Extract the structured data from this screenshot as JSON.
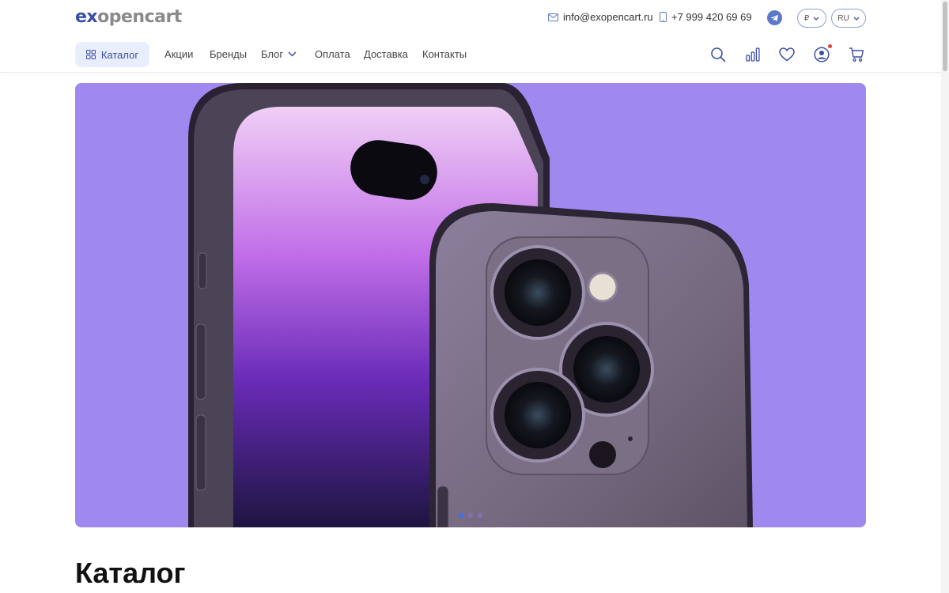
{
  "header": {
    "logo": {
      "ex": "ex",
      "rest": "opencart"
    },
    "email": "info@exopencart.ru",
    "phone": "+7 999 420 69 69",
    "currency": "₽",
    "language": "RU"
  },
  "nav": {
    "catalog_label": "Каталог",
    "items": [
      {
        "label": "Акции"
      },
      {
        "label": "Бренды"
      },
      {
        "label": "Блог"
      },
      {
        "label": "Оплата"
      },
      {
        "label": "Доставка"
      },
      {
        "label": "Контакты"
      }
    ]
  },
  "banner": {
    "slides": 3,
    "active_slide": 1,
    "background": "#9f89ef"
  },
  "section": {
    "title": "Каталог"
  },
  "colors": {
    "accent": "#3a4fa3",
    "logo_gray": "#8a8a8a",
    "catalog_bg": "#e8eefb"
  },
  "icons": [
    "mail-icon",
    "phone-icon",
    "telegram-icon",
    "grid-icon",
    "search-icon",
    "compare-icon",
    "heart-icon",
    "user-icon",
    "cart-icon"
  ]
}
